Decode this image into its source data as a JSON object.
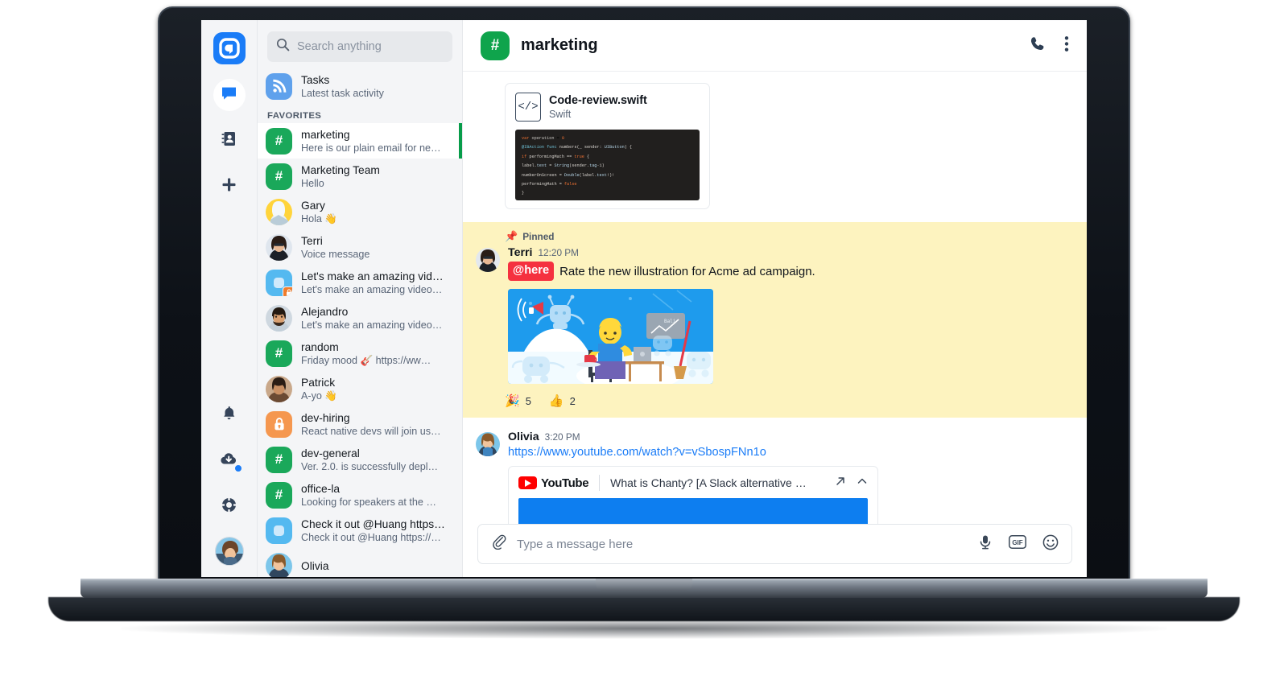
{
  "app": {
    "brand_color": "#1a7cf7",
    "accent_green": "#079c4a",
    "logo_icon": "chanty-logo-icon"
  },
  "rail": {
    "items": [
      {
        "name": "chat",
        "icon": "chat-bubble-icon",
        "active": true
      },
      {
        "name": "contacts",
        "icon": "contacts-book-icon",
        "active": false
      },
      {
        "name": "add",
        "icon": "plus-icon",
        "active": false
      }
    ],
    "bottom": [
      {
        "name": "notifications",
        "icon": "bell-icon",
        "badge": false
      },
      {
        "name": "downloads",
        "icon": "cloud-download-icon",
        "badge": true
      },
      {
        "name": "help",
        "icon": "lifebuoy-icon",
        "badge": false
      }
    ],
    "avatar": "user-avatar"
  },
  "search": {
    "placeholder": "Search anything",
    "value": "",
    "icon": "search-icon"
  },
  "sidebar": {
    "tasks": {
      "title": "Tasks",
      "subtitle": "Latest task activity",
      "icon": "rss-feed-icon"
    },
    "section_label": "FAVORITES",
    "items": [
      {
        "title": "marketing",
        "subtitle": "Here is our plain email for ne…",
        "kind": "channel",
        "selected": true
      },
      {
        "title": "Marketing Team",
        "subtitle": "Hello",
        "kind": "channel",
        "selected": false
      },
      {
        "title": "Gary",
        "subtitle": "Hola 👋",
        "kind": "person-gary",
        "selected": false
      },
      {
        "title": "Terri",
        "subtitle": "Voice message",
        "kind": "person-terri",
        "selected": false
      },
      {
        "title": "Let's make an amazing vid…",
        "subtitle": "Let's make an amazing video…",
        "kind": "group-private",
        "selected": false
      },
      {
        "title": "Alejandro",
        "subtitle": "Let's make an amazing video…",
        "kind": "person-alejandro",
        "selected": false
      },
      {
        "title": "random",
        "subtitle": "Friday mood 🎸 https://ww…",
        "kind": "channel",
        "selected": false
      },
      {
        "title": "Patrick",
        "subtitle": "A-yo 👋",
        "kind": "person-patrick",
        "selected": false
      },
      {
        "title": "dev-hiring",
        "subtitle": "React native devs will join us…",
        "kind": "private-channel",
        "selected": false
      },
      {
        "title": "dev-general",
        "subtitle": "Ver. 2.0. is successfully depl…",
        "kind": "channel",
        "selected": false
      },
      {
        "title": "office-la",
        "subtitle": "Looking for speakers at the …",
        "kind": "channel",
        "selected": false
      },
      {
        "title": "Check it out @Huang https…",
        "subtitle": "Check it out @Huang https://…",
        "kind": "group",
        "selected": false
      },
      {
        "title": "Olivia",
        "subtitle": "",
        "kind": "person-olivia",
        "selected": false
      }
    ]
  },
  "chat": {
    "channel_name": "marketing",
    "channel_icon": "hash-icon",
    "header_actions": [
      {
        "name": "call",
        "icon": "phone-icon"
      },
      {
        "name": "more",
        "icon": "kebab-menu-icon"
      }
    ]
  },
  "file_card": {
    "name": "Code-review.swift",
    "type": "Swift",
    "icon": "code-file-icon",
    "code_lines": [
      "var operation = 0",
      "@IBAction func numbers(_ sender: UIButton) {",
      "if performingMath == true {",
      "label.text = String(sender.tag-1)",
      "numberOnScreen = Double(label.text!)!",
      "performingMath = false",
      "}"
    ]
  },
  "pinned_message": {
    "pin_label": "Pinned",
    "pin_icon": "pushpin-icon",
    "author": "Terri",
    "time": "12:20 PM",
    "mention": "@here",
    "text": "Rate the new illustration for Acme ad campaign.",
    "image_alt": "acme-ad-illustration",
    "reactions": [
      {
        "emoji": "🎉",
        "count": "5"
      },
      {
        "emoji": "👍",
        "count": "2"
      }
    ]
  },
  "link_message": {
    "author": "Olivia",
    "time": "3:20 PM",
    "url": "https://www.youtube.com/watch?v=vSbospFNn1o",
    "preview": {
      "provider": "YouTube",
      "title": "What is Chanty? [A Slack alternative …",
      "actions": [
        {
          "name": "open-external",
          "icon": "external-link-icon"
        },
        {
          "name": "collapse",
          "icon": "chevron-up-icon"
        }
      ]
    }
  },
  "composer": {
    "placeholder": "Type a message here",
    "value": "",
    "attach_icon": "paperclip-icon",
    "actions": [
      {
        "name": "voice",
        "icon": "microphone-icon",
        "label": ""
      },
      {
        "name": "gif",
        "icon": "gif-icon",
        "label": "GIF"
      },
      {
        "name": "emoji",
        "icon": "smiley-icon",
        "label": ""
      }
    ]
  }
}
